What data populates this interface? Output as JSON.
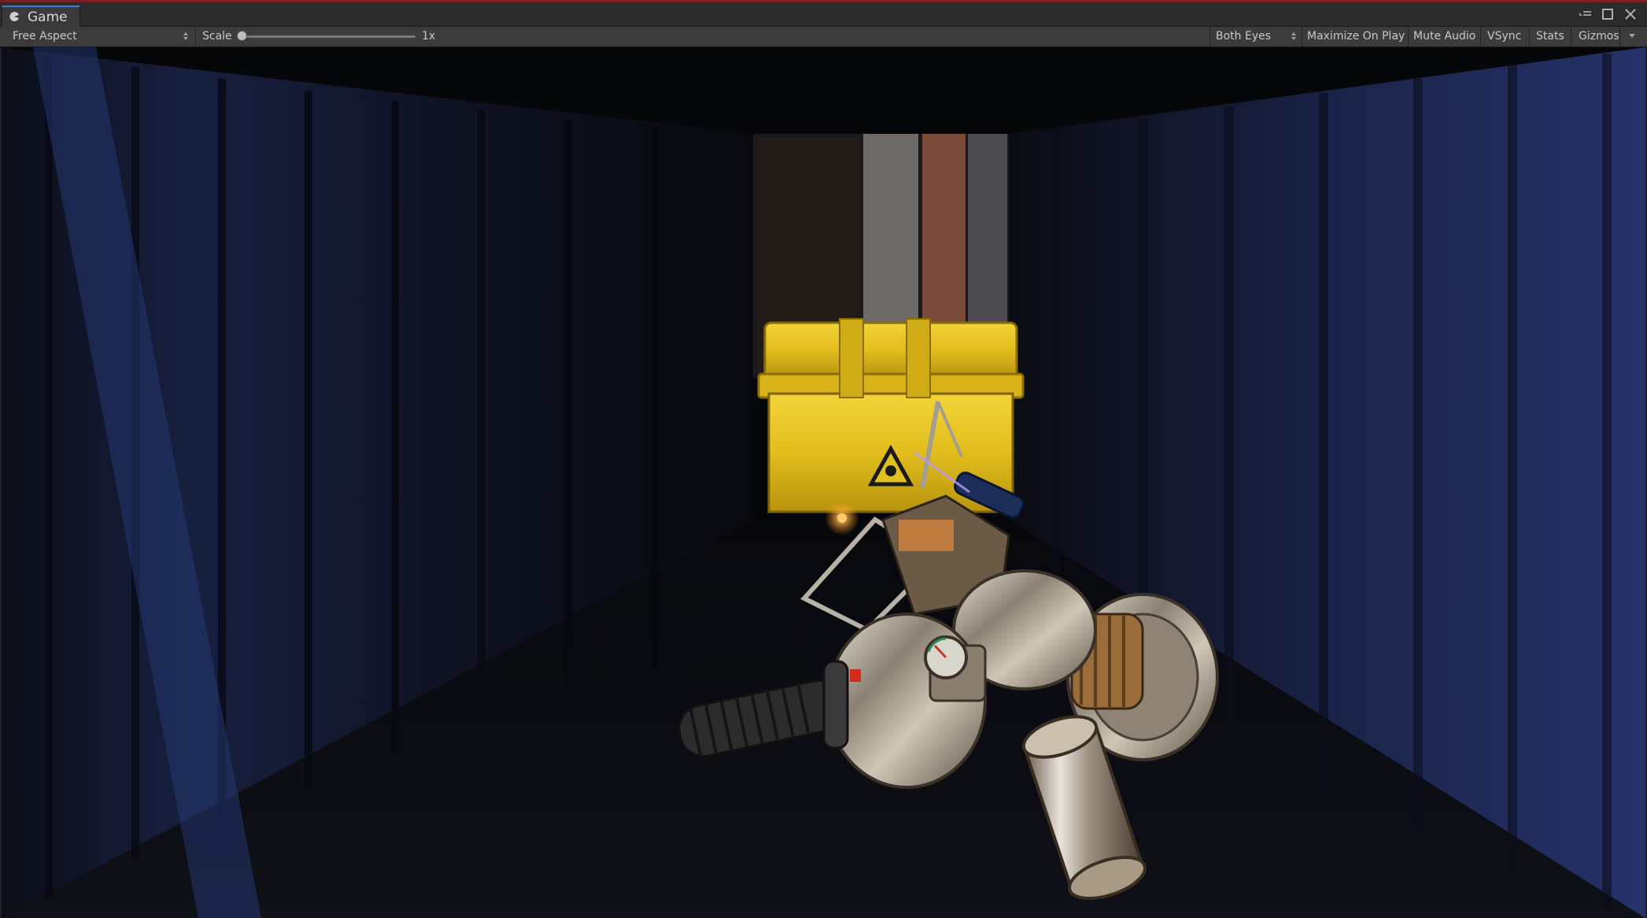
{
  "window": {
    "tab_label": "Game",
    "tab_icon": "pacman-game-icon"
  },
  "toolbar": {
    "aspect_label": "Free Aspect",
    "scale_label": "Scale",
    "scale_value": "1x",
    "scale_slider_fraction": 0,
    "eyes_label": "Both Eyes",
    "maximize_label": "Maximize On Play",
    "mute_label": "Mute Audio",
    "vsync_label": "VSync",
    "stats_label": "Stats",
    "gizmos_label": "Gizmos"
  },
  "scene": {
    "description_visible": false
  },
  "colors": {
    "tab_accent": "#3f7fd1",
    "crate_yellow": "#e6c21f",
    "window_top": "#7a1f24"
  }
}
